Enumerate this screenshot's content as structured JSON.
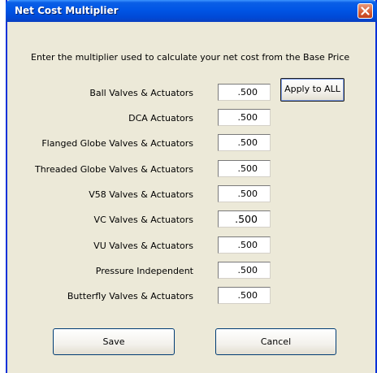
{
  "window": {
    "title": "Net Cost Multiplier"
  },
  "prompt": "Enter the multiplier used to calculate your net cost from the Base Price",
  "rows": [
    {
      "label": "Ball Valves & Actuators",
      "value": ".500"
    },
    {
      "label": "DCA Actuators",
      "value": ".500"
    },
    {
      "label": "Flanged Globe Valves & Actuators",
      "value": ".500"
    },
    {
      "label": "Threaded Globe Valves & Actuators",
      "value": ".500"
    },
    {
      "label": "V58 Valves & Actuators",
      "value": ".500"
    },
    {
      "label": "VC Valves & Actuators",
      "value": ".500"
    },
    {
      "label": "VU Valves & Actuators",
      "value": ".500"
    },
    {
      "label": "Pressure Independent",
      "value": ".500"
    },
    {
      "label": "Butterfly Valves & Actuators",
      "value": ".500"
    }
  ],
  "buttons": {
    "apply_all": "Apply to ALL",
    "save": "Save",
    "cancel": "Cancel"
  },
  "icons": {
    "close": "close-icon"
  },
  "colors": {
    "titlebar": "#0055e5",
    "dialog_bg": "#ece9d8",
    "close": "#d45a32"
  }
}
